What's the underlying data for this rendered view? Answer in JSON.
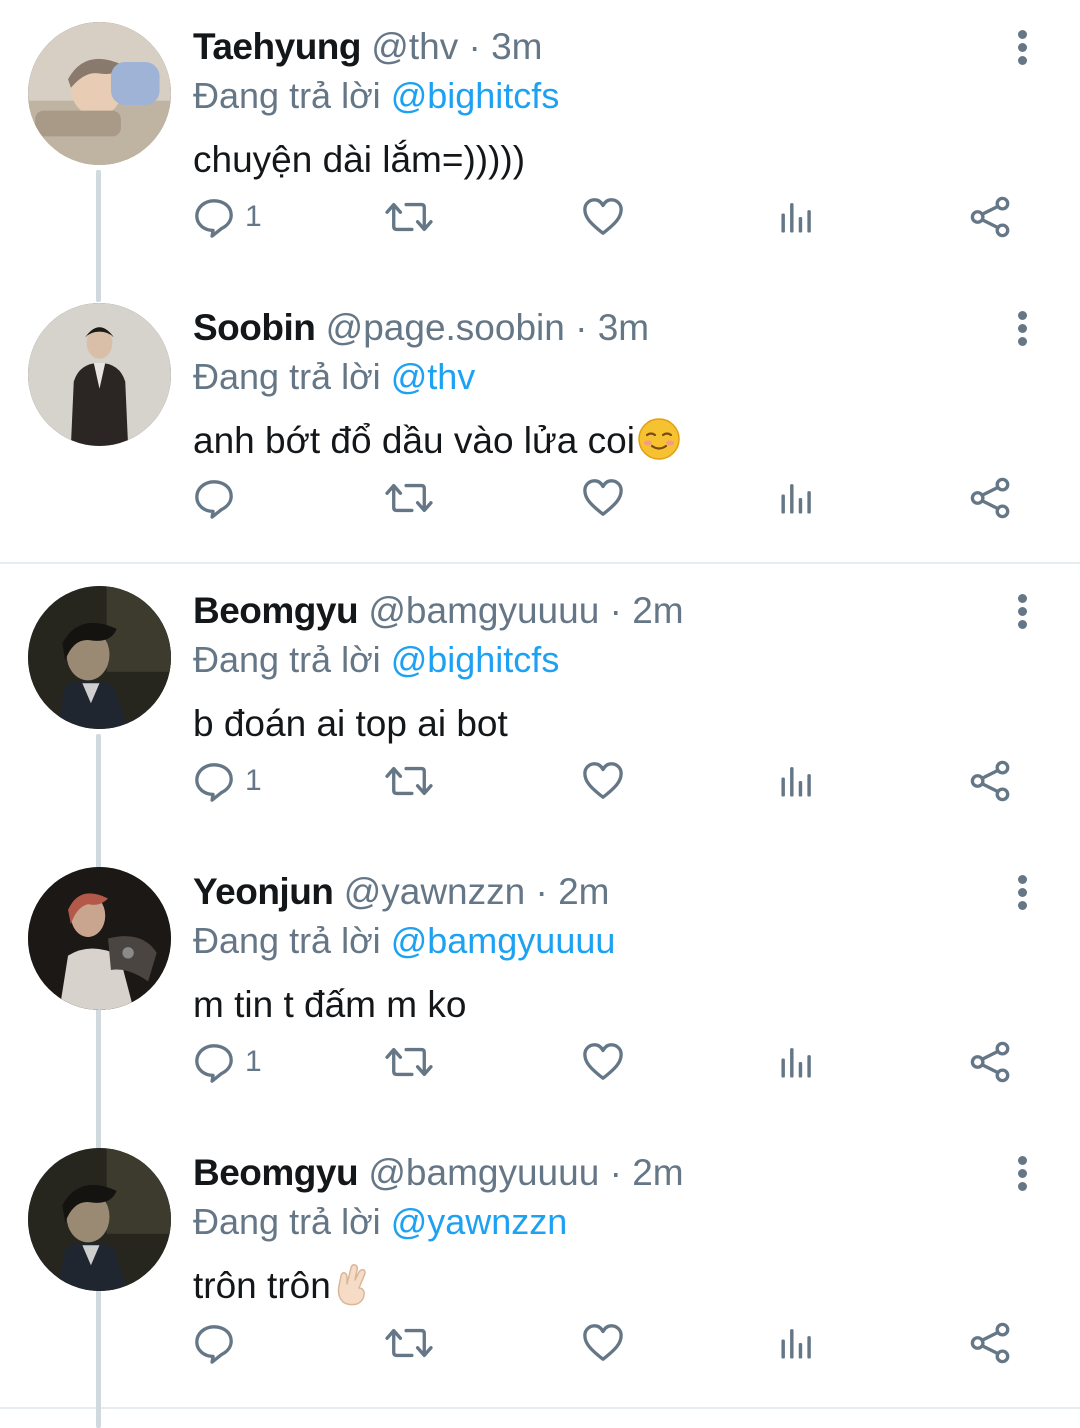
{
  "reply_prefix": "Đang trả lời",
  "colors": {
    "link": "#1da1f2",
    "secondary": "#657786",
    "primary_text": "#14171a",
    "thread_line": "#cfd9de",
    "divider": "#e6ecf0"
  },
  "icons": {
    "reply": "reply-icon",
    "retweet": "retweet-icon",
    "like": "heart-icon",
    "analytics": "analytics-icon",
    "share": "share-icon",
    "more": "more-vertical-icon"
  },
  "tweets": [
    {
      "name": "Taehyung",
      "handle": "@thv",
      "dot": "·",
      "time": "3m",
      "reply_to": "@bighitcfs",
      "text": "chuyện dài lắm=)))))",
      "reply_count": "1"
    },
    {
      "name": "Soobin",
      "handle": "@page.soobin",
      "dot": "·",
      "time": "3m",
      "reply_to": "@thv",
      "text": "anh bớt đổ dầu vào lửa coi",
      "reply_count": ""
    },
    {
      "name": "Beomgyu",
      "handle": "@bamgyuuuu",
      "dot": "·",
      "time": "2m",
      "reply_to": "@bighitcfs",
      "text": "b đoán ai top ai bot",
      "reply_count": "1"
    },
    {
      "name": "Yeonjun",
      "handle": "@yawnzzn",
      "dot": "·",
      "time": "2m",
      "reply_to": "@bamgyuuuu",
      "text": "m tin t đấm m ko",
      "reply_count": "1"
    },
    {
      "name": "Beomgyu",
      "handle": "@bamgyuuuu",
      "dot": "·",
      "time": "2m",
      "reply_to": "@yawnzzn",
      "text": "trôn trôn",
      "reply_count": ""
    }
  ]
}
